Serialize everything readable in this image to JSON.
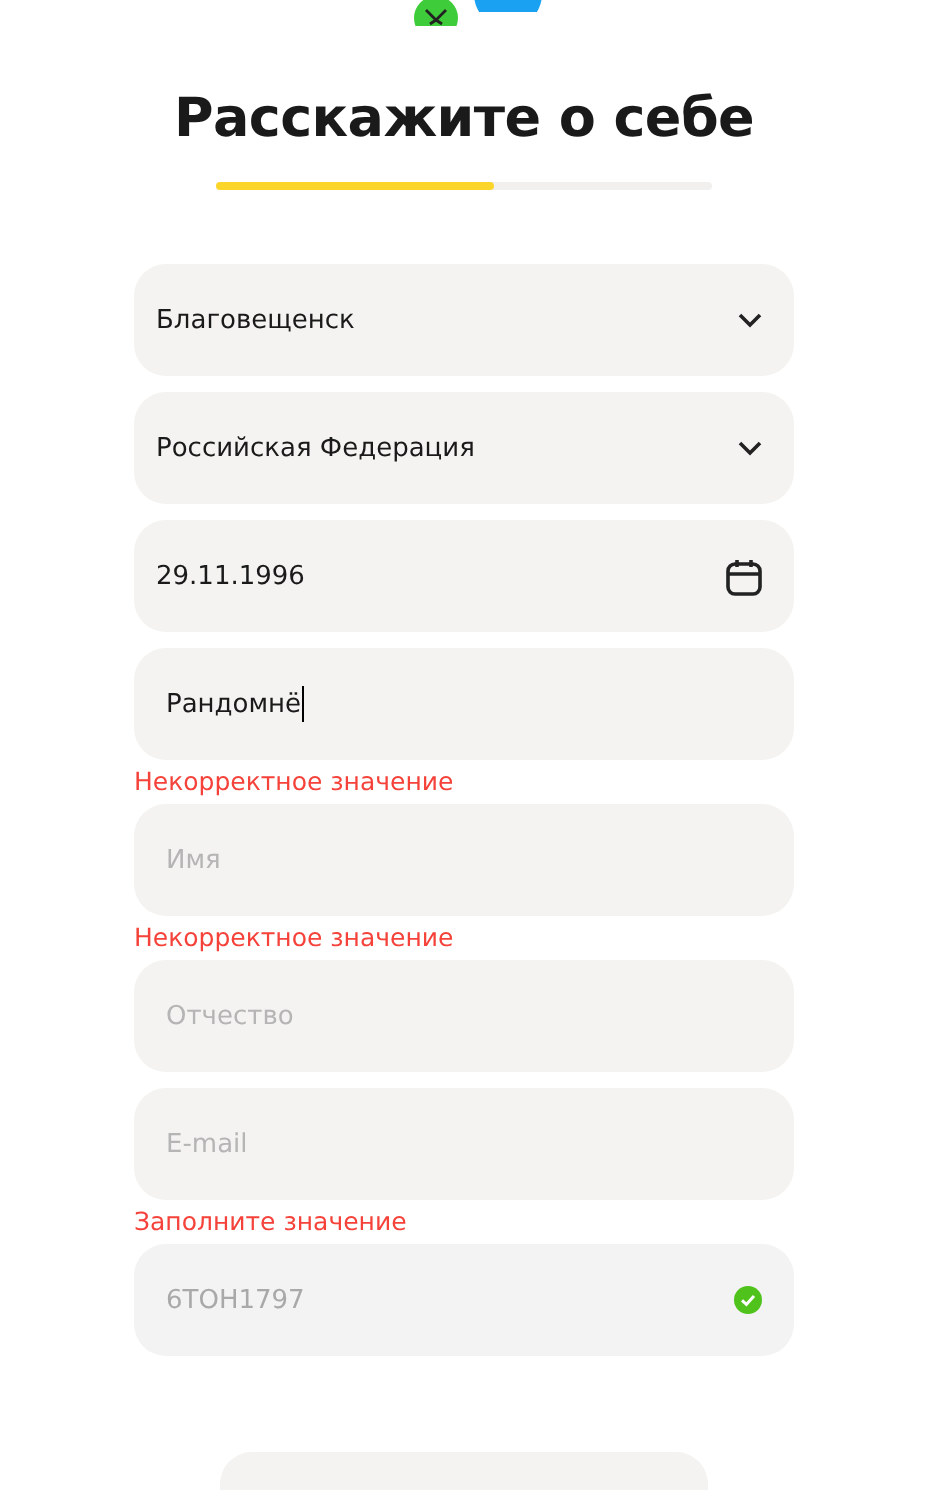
{
  "title": "Расскажите о себе",
  "progress": {
    "level": 0.56
  },
  "fields": [
    {
      "kind": "select",
      "value": "Благовещенск"
    },
    {
      "kind": "select",
      "value": "Российская Федерация"
    },
    {
      "kind": "date",
      "value": "29.11.1996"
    },
    {
      "kind": "text",
      "value": "Рандомнё",
      "focused": true,
      "error": "Некорректное значение"
    },
    {
      "kind": "text",
      "placeholder": "Имя",
      "error": "Некорректное значение"
    },
    {
      "kind": "text",
      "placeholder": "Отчество"
    },
    {
      "kind": "text",
      "placeholder": "E-mail",
      "error": "Заполните значение"
    },
    {
      "kind": "verified",
      "value": "6TOH1797",
      "disabled": true
    }
  ]
}
